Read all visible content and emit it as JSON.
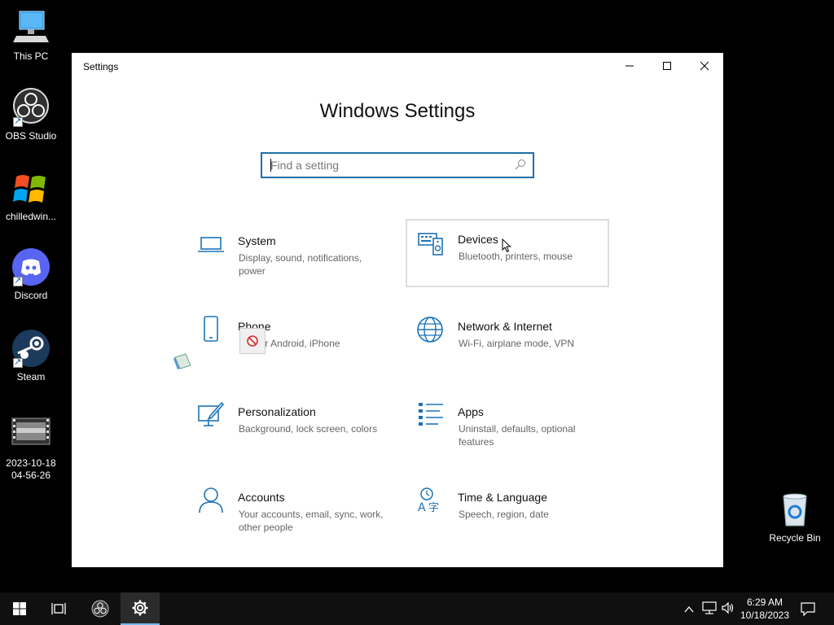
{
  "desktop": {
    "icons": [
      {
        "label": "This PC",
        "icon": "computer-icon"
      },
      {
        "label": "OBS Studio",
        "icon": "obs-icon"
      },
      {
        "label": "chilledwin...",
        "icon": "windows-logo-icon"
      },
      {
        "label": "Discord",
        "icon": "discord-icon"
      },
      {
        "label": "Steam",
        "icon": "steam-icon"
      },
      {
        "label_line1": "2023-10-18",
        "label_line2": "04-56-26",
        "icon": "video-file-icon"
      }
    ],
    "recycle_bin": {
      "label": "Recycle Bin",
      "icon": "recycle-bin-icon"
    }
  },
  "window": {
    "title": "Settings",
    "heading": "Windows Settings",
    "search": {
      "placeholder": "Find a setting",
      "value": ""
    },
    "tiles": [
      {
        "name": "System",
        "desc": "Display, sound, notifications, power",
        "icon": "laptop-icon"
      },
      {
        "name": "Devices",
        "desc": "Bluetooth, printers, mouse",
        "icon": "devices-icon"
      },
      {
        "name": "Phone",
        "desc": "Link your Android, iPhone",
        "desc_visible": "our Android, iPhone",
        "icon": "phone-icon"
      },
      {
        "name": "Network & Internet",
        "desc": "Wi-Fi, airplane mode, VPN",
        "icon": "globe-icon"
      },
      {
        "name": "Personalization",
        "desc": "Background, lock screen, colors",
        "icon": "personalization-icon"
      },
      {
        "name": "Apps",
        "desc": "Uninstall, defaults, optional features",
        "icon": "apps-list-icon"
      },
      {
        "name": "Accounts",
        "desc": "Your accounts, email, sync, work, other people",
        "icon": "person-icon"
      },
      {
        "name": "Time & Language",
        "desc": "Speech, region, date",
        "icon": "time-language-icon"
      }
    ]
  },
  "taskbar": {
    "time": "6:29 AM",
    "date": "10/18/2023"
  },
  "colors": {
    "accent": "#0078d7",
    "desktop": "#000000",
    "taskbar": "#101010"
  }
}
